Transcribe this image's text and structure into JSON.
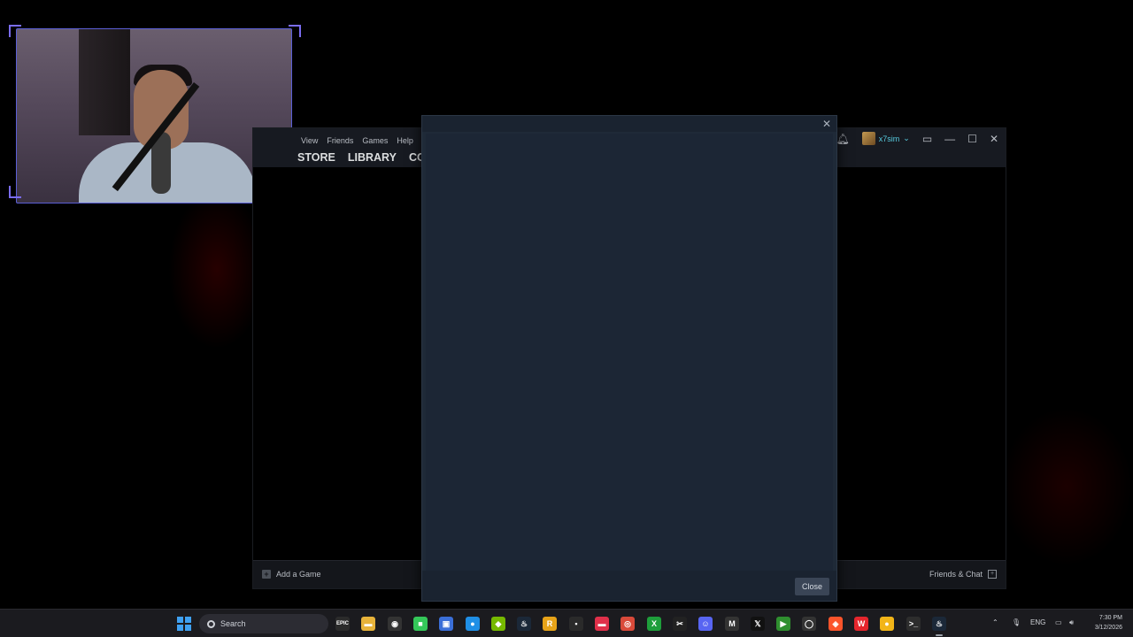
{
  "steam": {
    "menu": [
      "View",
      "Friends",
      "Games",
      "Help"
    ],
    "tabs": [
      "STORE",
      "LIBRARY",
      "COM"
    ],
    "username": "x7sim",
    "add_game": "Add a Game",
    "friends_chat": "Friends & Chat"
  },
  "dialog": {
    "close_label": "Close",
    "close_x": "✕"
  },
  "taskbar": {
    "search_label": "Search",
    "language": "ENG",
    "time": "7:30 PM",
    "date": "3/12/2026",
    "apps": [
      {
        "name": "epic-games-icon",
        "glyph": "EPIC",
        "color": "#2b2b2b"
      },
      {
        "name": "file-explorer-icon",
        "glyph": "▬",
        "color": "#e8b33a"
      },
      {
        "name": "app-icon",
        "glyph": "◉",
        "color": "#333"
      },
      {
        "name": "android-app-icon",
        "glyph": "■",
        "color": "#34c759"
      },
      {
        "name": "blue-app-icon",
        "glyph": "▣",
        "color": "#3b6fd8"
      },
      {
        "name": "edge-app-icon",
        "glyph": "●",
        "color": "#1f8fe6"
      },
      {
        "name": "nvidia-icon",
        "glyph": "◆",
        "color": "#76b900"
      },
      {
        "name": "steam-icon",
        "glyph": "♨",
        "color": "#1b2838"
      },
      {
        "name": "rockstar-icon",
        "glyph": "R",
        "color": "#e7a318"
      },
      {
        "name": "dark-app-icon",
        "glyph": "▪",
        "color": "#2a2a2a"
      },
      {
        "name": "red-app-icon",
        "glyph": "▬",
        "color": "#e0304a"
      },
      {
        "name": "chrome-icon",
        "glyph": "◎",
        "color": "#d94a3a"
      },
      {
        "name": "xbox-icon",
        "glyph": "X",
        "color": "#1e9e3b"
      },
      {
        "name": "capcut-icon",
        "glyph": "✂",
        "color": "#222"
      },
      {
        "name": "discord-icon",
        "glyph": "☺",
        "color": "#5865f2"
      },
      {
        "name": "medal-icon",
        "glyph": "M",
        "color": "#333"
      },
      {
        "name": "x-app-icon",
        "glyph": "𝕏",
        "color": "#111"
      },
      {
        "name": "play-icon",
        "glyph": "▶",
        "color": "#2f8f2f"
      },
      {
        "name": "obs-icon",
        "glyph": "◯",
        "color": "#333"
      },
      {
        "name": "brave-icon",
        "glyph": "◈",
        "color": "#fb542b"
      },
      {
        "name": "wps-icon",
        "glyph": "W",
        "color": "#e5262d"
      },
      {
        "name": "yellow-app-icon",
        "glyph": "●",
        "color": "#f2b518"
      },
      {
        "name": "terminal-icon",
        "glyph": ">_",
        "color": "#2d2d2d"
      },
      {
        "name": "steam-active-icon",
        "glyph": "♨",
        "color": "#1b2838"
      }
    ]
  }
}
